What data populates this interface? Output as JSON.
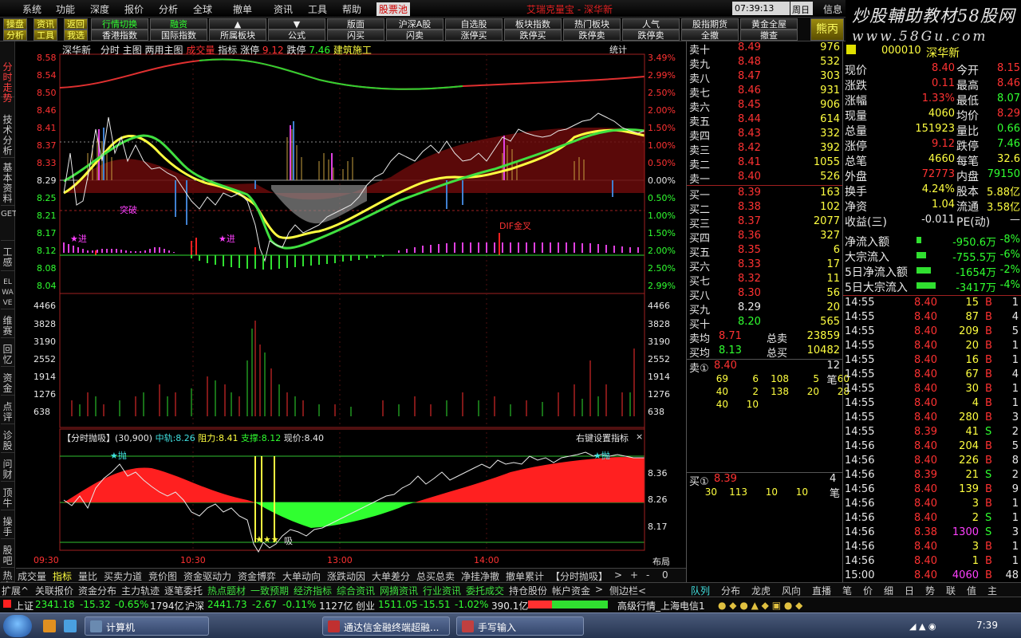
{
  "menu": {
    "items": [
      "系统",
      "功能",
      "深度",
      "报价",
      "分析",
      "全球",
      "撤单",
      "资讯",
      "工具",
      "帮助",
      "股票池"
    ],
    "title": "艾瑞克量宝 - 深华新",
    "time": "07:39:13",
    "day": "周日",
    "right": [
      "信息",
      "行"
    ]
  },
  "toolbar": {
    "row1": [
      "操盘",
      "资讯",
      "返回",
      "行情切换",
      "融资",
      "▲",
      "▼",
      "版面",
      "沪深A股",
      "自选股",
      "板块指数",
      "热门板块",
      "人气",
      "股指期货",
      "黄金全屋",
      "熊丙"
    ],
    "row2": [
      "分析",
      "工具",
      "我选",
      "香港指数",
      "国际指数",
      "所属板块",
      "公式",
      "闪买",
      "闪卖",
      "涨停买",
      "跌停买",
      "跌停卖",
      "跌停卖",
      "全撤",
      "撤查"
    ]
  },
  "brand": {
    "title": "炒股輔助教材58股网",
    "url": "www.58Gu.com"
  },
  "left_tabs": [
    "分时走势",
    "技术分析",
    "基本资料",
    "GET",
    "工感",
    "ELWAVE",
    "维赛",
    "回忆",
    "资金",
    "点评",
    "诊股",
    "问财",
    "顶牛",
    "操手",
    "股吧",
    "热力"
  ],
  "chart": {
    "header": {
      "name": "深华新",
      "mode": "分时",
      "main": "主图",
      "two": "两用主图",
      "cjl": "成交量",
      "ind": "指标",
      "zt_lbl": "涨停",
      "zt": "9.12",
      "dt_lbl": "跌停",
      "dt": "7.46",
      "ind_name": "建筑施工",
      "stat": "统计"
    },
    "left_prices": [
      "8.58",
      "8.54",
      "8.50",
      "8.46",
      "8.41",
      "8.37",
      "8.33",
      "8.29",
      "8.25",
      "8.21",
      "8.17",
      "8.12",
      "8.08",
      "8.04"
    ],
    "right_pcts": [
      "3.49%",
      "2.99%",
      "2.50%",
      "2.00%",
      "1.50%",
      "1.00%",
      "0.50%",
      "0.00%",
      "0.50%",
      "1.00%",
      "1.50%",
      "2.00%",
      "2.50%",
      "2.99%"
    ],
    "vol_ticks": [
      "4466",
      "3828",
      "3190",
      "2552",
      "1914",
      "1276",
      "638"
    ],
    "annotations": {
      "a1": "突破",
      "a2": "★进",
      "a3": "★进",
      "a4": "DIF金叉"
    },
    "lower": {
      "title": "【分时抛吸】(30,900)",
      "zg_lbl": "中轨:",
      "zg": "8.26",
      "zl_lbl": "阻力:",
      "zl": "8.41",
      "zc_lbl": "支撑:",
      "zc": "8.12",
      "xj_lbl": "现价:",
      "xj": "8.40",
      "right_btn": "右键设置指标",
      "ticks": [
        "8.36",
        "8.26",
        "8.17"
      ],
      "pao": "★抛",
      "xi": "吸"
    },
    "times": [
      "09:30",
      "10:30",
      "13:00",
      "14:00"
    ],
    "layout_lbl": "布局"
  },
  "quote": {
    "sell": [
      {
        "l": "卖十",
        "p": "8.49",
        "v": "976"
      },
      {
        "l": "卖九",
        "p": "8.48",
        "v": "532"
      },
      {
        "l": "卖八",
        "p": "8.47",
        "v": "303"
      },
      {
        "l": "卖七",
        "p": "8.46",
        "v": "931"
      },
      {
        "l": "卖六",
        "p": "8.45",
        "v": "906"
      },
      {
        "l": "卖五",
        "p": "8.44",
        "v": "614"
      },
      {
        "l": "卖四",
        "p": "8.43",
        "v": "332"
      },
      {
        "l": "卖三",
        "p": "8.42",
        "v": "392"
      },
      {
        "l": "卖二",
        "p": "8.41",
        "v": "1055"
      },
      {
        "l": "卖一",
        "p": "8.40",
        "v": "526"
      }
    ],
    "buy": [
      {
        "l": "买一",
        "p": "8.39",
        "v": "163"
      },
      {
        "l": "买二",
        "p": "8.38",
        "v": "102"
      },
      {
        "l": "买三",
        "p": "8.37",
        "v": "2077"
      },
      {
        "l": "买四",
        "p": "8.36",
        "v": "327"
      },
      {
        "l": "买五",
        "p": "8.35",
        "v": "6"
      },
      {
        "l": "买六",
        "p": "8.33",
        "v": "17"
      },
      {
        "l": "买七",
        "p": "8.32",
        "v": "11"
      },
      {
        "l": "买八",
        "p": "8.30",
        "v": "56"
      },
      {
        "l": "买九",
        "p": "8.29",
        "v": "20"
      },
      {
        "l": "买十",
        "p": "8.20",
        "v": "565"
      }
    ],
    "avg_sell_lbl": "卖均",
    "avg_sell": "8.71",
    "tot_sell_lbl": "总卖",
    "tot_sell": "23859",
    "avg_buy_lbl": "买均",
    "avg_buy": "8.13",
    "tot_buy_lbl": "总买",
    "tot_buy": "10482",
    "s1_lbl": "卖①",
    "s1_p": "8.40",
    "s1_n": "12笔",
    "s1_q": [
      [
        "69",
        "6",
        "108",
        "5",
        "60"
      ],
      [
        "40",
        "2",
        "138",
        "20",
        "28"
      ],
      [
        "40",
        "10"
      ]
    ],
    "b1_lbl": "买①",
    "b1_p": "8.39",
    "b1_n": "4笔",
    "b1_q": [
      "30",
      "113",
      "10",
      "10"
    ]
  },
  "info": {
    "code": "000010",
    "name": "深华新",
    "rows": [
      {
        "a": "现价",
        "av": "8.40",
        "b": "今开",
        "bv": "8.15"
      },
      {
        "a": "涨跌",
        "av": "0.11",
        "b": "最高",
        "bv": "8.46"
      },
      {
        "a": "涨幅",
        "av": "1.33%",
        "b": "最低",
        "bv": "8.07"
      },
      {
        "a": "现量",
        "av": "4060",
        "b": "均价",
        "bv": "8.29"
      },
      {
        "a": "总量",
        "av": "151923",
        "b": "量比",
        "bv": "0.66"
      },
      {
        "a": "涨停",
        "av": "9.12",
        "b": "跌停",
        "bv": "7.46"
      },
      {
        "a": "总笔",
        "av": "4660",
        "b": "每笔",
        "bv": "32.6"
      },
      {
        "a": "外盘",
        "av": "72773",
        "b": "内盘",
        "bv": "79150"
      },
      {
        "a": "换手",
        "av": "4.24%",
        "b": "股本",
        "bv": "5.88亿"
      },
      {
        "a": "净资",
        "av": "1.04",
        "b": "流通",
        "bv": "3.58亿"
      },
      {
        "a": "收益(三)",
        "av": "-0.011",
        "b": "PE(动)",
        "bv": "—"
      }
    ],
    "flow": [
      {
        "l": "净流入额",
        "v": "-950.6万",
        "p": "-8%"
      },
      {
        "l": "大宗流入",
        "v": "-755.5万",
        "p": "-6%"
      },
      {
        "l": "5日净流入额",
        "v": "-1654万",
        "p": "-2%"
      },
      {
        "l": "5日大宗流入",
        "v": "-3417万",
        "p": "-4%"
      }
    ],
    "ticks": [
      [
        "14:55",
        "8.40",
        "15",
        "B",
        "1"
      ],
      [
        "14:55",
        "8.40",
        "87",
        "B",
        "4"
      ],
      [
        "14:55",
        "8.40",
        "209",
        "B",
        "5"
      ],
      [
        "14:55",
        "8.40",
        "20",
        "B",
        "1"
      ],
      [
        "14:55",
        "8.40",
        "16",
        "B",
        "1"
      ],
      [
        "14:55",
        "8.40",
        "67",
        "B",
        "4"
      ],
      [
        "14:55",
        "8.40",
        "30",
        "B",
        "1"
      ],
      [
        "14:55",
        "8.40",
        "4",
        "B",
        "1"
      ],
      [
        "14:55",
        "8.40",
        "280",
        "B",
        "3"
      ],
      [
        "14:55",
        "8.39",
        "41",
        "S",
        "2"
      ],
      [
        "14:56",
        "8.40",
        "204",
        "B",
        "5"
      ],
      [
        "14:56",
        "8.40",
        "226",
        "B",
        "8"
      ],
      [
        "14:56",
        "8.39",
        "21",
        "S",
        "2"
      ],
      [
        "14:56",
        "8.40",
        "139",
        "B",
        "9"
      ],
      [
        "14:56",
        "8.40",
        "3",
        "B",
        "1"
      ],
      [
        "14:56",
        "8.40",
        "2",
        "S",
        "1"
      ],
      [
        "14:56",
        "8.38",
        "1300",
        "S",
        "3"
      ],
      [
        "14:56",
        "8.40",
        "3",
        "B",
        "1"
      ],
      [
        "14:56",
        "8.40",
        "1",
        "B",
        "1"
      ],
      [
        "15:00",
        "8.40",
        "4060",
        "B",
        "48"
      ]
    ]
  },
  "bottom_tabs": [
    "成交量",
    "指标",
    "量比",
    "买卖力道",
    "竞价图",
    "资金驱动力",
    "资金博弈",
    "大单动向",
    "涨跌动因",
    "大单差分",
    "总买总卖",
    "净挂净撤",
    "撤单累计",
    "【分时抛吸】",
    ">",
    "+",
    "-",
    "0"
  ],
  "bottom_tabs2": [
    "扩展^",
    "关联报价",
    "资金分布",
    "主力轨迹",
    "逐笔委托",
    "热点题材",
    "一致预期",
    "经济指标",
    "综合资讯",
    "网摘资讯",
    "行业资讯",
    "委托成交",
    "持仓股份",
    "帐户资金",
    ">",
    "侧边栏<"
  ],
  "bottom_tabs3": [
    "队列",
    "分布",
    "龙虎",
    "风向",
    "直播",
    "笔",
    "价",
    "细",
    "日",
    "势",
    "联",
    "值",
    "主"
  ],
  "indexbar": {
    "sh_lbl": "上证",
    "sh": "2341.18",
    "sh_chg": "-15.32",
    "sh_pct": "-0.65%",
    "sh_amt": "1794亿",
    "sz_lbl": "沪深",
    "sz": "2441.73",
    "sz_chg": "-2.67",
    "sz_pct": "-0.11%",
    "sz_amt": "1127亿",
    "cy_lbl": "创业",
    "cy": "1511.05",
    "cy_chg": "-15.51",
    "cy_pct": "-1.02%",
    "cy_amt": "390.1亿",
    "feed": "高级行情_上海电信1"
  },
  "taskbar": {
    "tasks": [
      "计算机",
      "通达信金融终端超融...",
      "手写输入"
    ],
    "clock": "7:39"
  }
}
